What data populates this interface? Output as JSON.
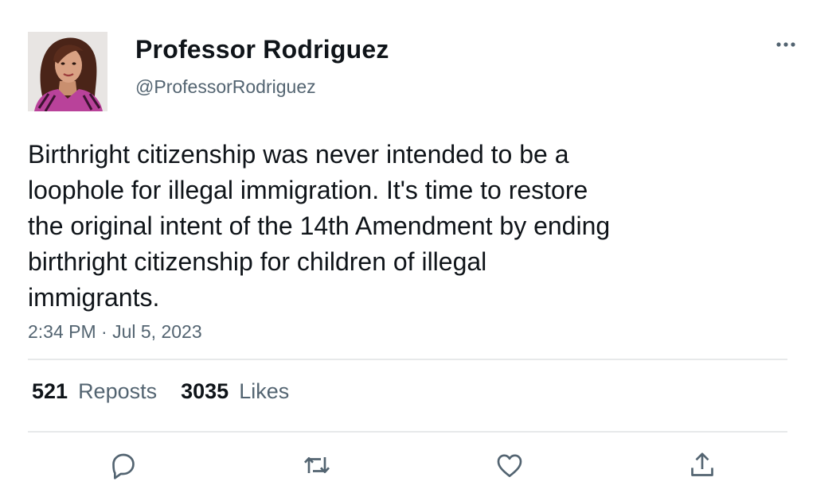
{
  "author": {
    "display_name": "Professor Rodriguez",
    "handle": "@ProfessorRodriguez"
  },
  "tweet": {
    "text": "Birthright citizenship was never intended to be a\nloophole for illegal immigration. It's time to restore\nthe original intent of the 14th Amendment by ending\nbirthright citizenship for children of illegal\nimmigrants.",
    "timestamp": "2:34 PM · Jul 5, 2023"
  },
  "stats": {
    "reposts_count": "521",
    "reposts_label": "Reposts",
    "likes_count": "3035",
    "likes_label": "Likes"
  },
  "actions": {
    "icons": [
      "reply-icon",
      "repost-icon",
      "like-icon",
      "share-icon"
    ]
  },
  "colors": {
    "text_primary": "#0f1419",
    "text_secondary": "#536471",
    "divider": "#e7e9ea"
  }
}
